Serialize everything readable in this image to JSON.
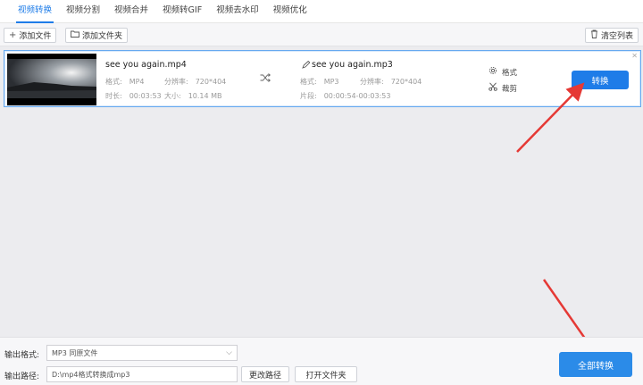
{
  "tabs": [
    {
      "label": "视频转换",
      "active": true
    },
    {
      "label": "视频分割"
    },
    {
      "label": "视频合并"
    },
    {
      "label": "视频转GIF"
    },
    {
      "label": "视频去水印"
    },
    {
      "label": "视频优化"
    }
  ],
  "toolbar": {
    "add_file": "添加文件",
    "add_folder": "添加文件夹",
    "clear_list": "清空列表"
  },
  "file": {
    "source_name": "see you again.mp4",
    "format_label": "格式:",
    "format": "MP4",
    "resolution_label": "分辨率:",
    "resolution": "720*404",
    "duration_label": "时长:",
    "duration": "00:03:53",
    "size_label": "大小:",
    "size": "10.14 MB",
    "output_name": "see you again.mp3",
    "out_format_label": "格式:",
    "out_format": "MP3",
    "out_resolution_label": "分辨率:",
    "out_resolution": "720*404",
    "segment_label": "片段:",
    "segment": "00:00:54-00:03:53",
    "opt_format": "格式",
    "opt_cut": "裁剪",
    "convert": "转换"
  },
  "bottom": {
    "format_label": "输出格式:",
    "format_value": "MP3  同原文件",
    "path_label": "输出路径:",
    "path_value": "D:\\mp4格式转换成mp3",
    "change_path": "更改路径",
    "open_folder": "打开文件夹",
    "convert_all": "全部转换"
  },
  "colors": {
    "accent": "#1e7ce8",
    "arrow": "#e53935"
  }
}
